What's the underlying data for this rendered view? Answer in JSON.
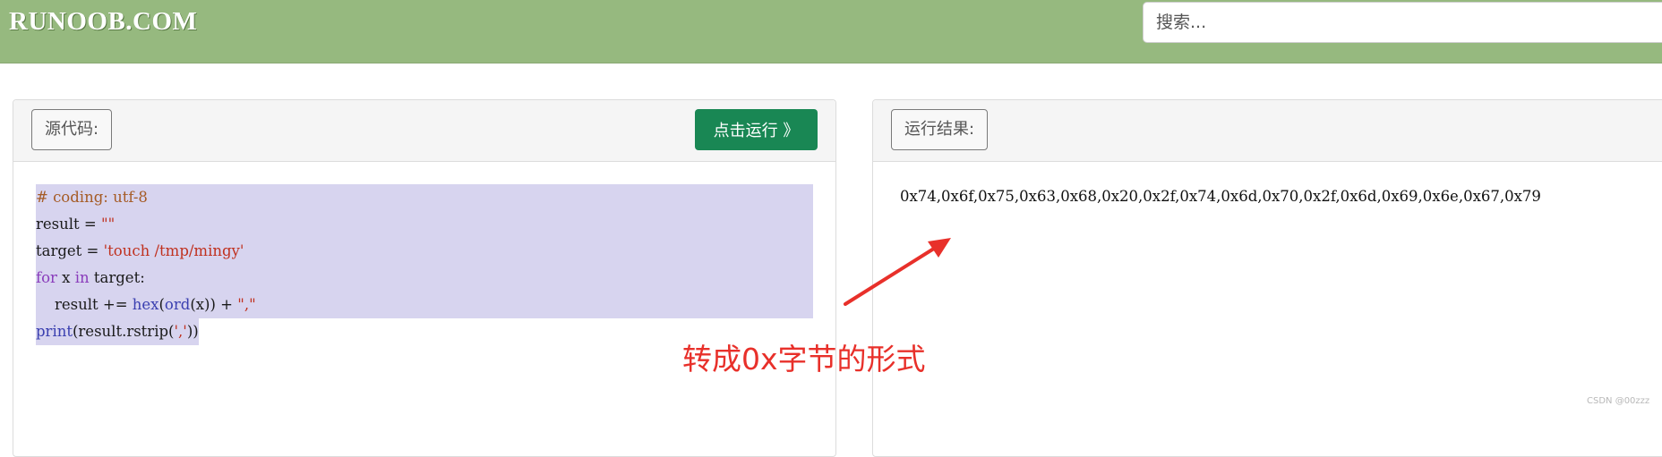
{
  "header": {
    "logo": "RUNOOB.COM",
    "search_placeholder": "搜索..."
  },
  "source_panel": {
    "label": "源代码:",
    "run_button": "点击运行 》",
    "code": {
      "line1": "# coding: utf-8",
      "line2_a": "result = ",
      "line2_b": "\"\"",
      "line3_a": "target = ",
      "line3_b": "'touch /tmp/mingy'",
      "line4_kw1": "for",
      "line4_b": " x ",
      "line4_kw2": "in",
      "line4_c": " target:",
      "line5_a": "    result += ",
      "line5_fn1": "hex",
      "line5_b": "(",
      "line5_fn2": "ord",
      "line5_c": "(x)) + ",
      "line5_d": "\",\"",
      "line6_fn": "print",
      "line6_a": "(result.rstrip(",
      "line6_b": "','",
      "line6_c": "))"
    }
  },
  "result_panel": {
    "label": "运行结果:",
    "output": "0x74,0x6f,0x75,0x63,0x68,0x20,0x2f,0x74,0x6d,0x70,0x2f,0x6d,0x69,0x6e,0x67,0x79"
  },
  "annotation": {
    "text": "转成0x字节的形式",
    "color": "#e8302a"
  },
  "watermark": "CSDN @00zzz",
  "colors": {
    "header_bg": "#96b97f",
    "run_button_bg": "#198754",
    "selection_bg": "#d7d4ef"
  },
  "icons": [
    "arrow-icon"
  ]
}
